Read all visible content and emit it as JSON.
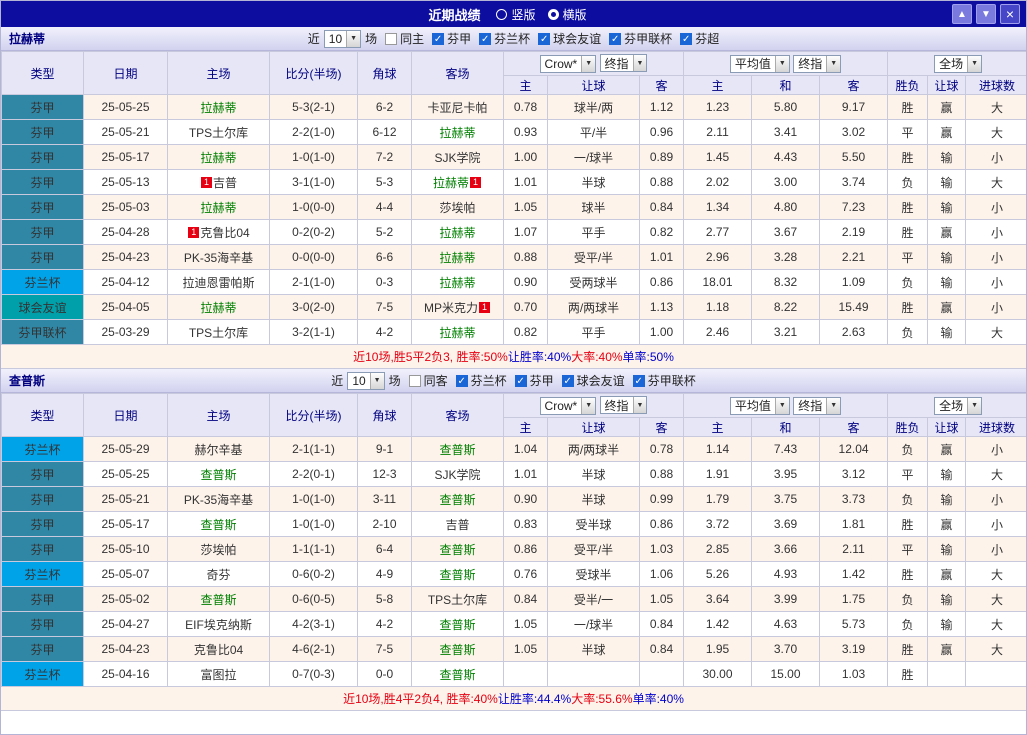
{
  "titlebar": {
    "title": "近期战绩",
    "radios": [
      {
        "label": "竖版",
        "selected": false
      },
      {
        "label": "横版",
        "selected": true
      }
    ],
    "buttons": {
      "up": "▲",
      "down": "▼",
      "close": "×"
    }
  },
  "table_header": {
    "type": "类型",
    "date": "日期",
    "home": "主场",
    "score": "比分(半场)",
    "corner": "角球",
    "away": "客场",
    "odds_select1": "Crow*",
    "odds_select2": "终指",
    "odds_home": "主",
    "odds_line": "让球",
    "odds_away": "客",
    "avg_select1": "平均值",
    "avg_select2": "终指",
    "avg_home": "主",
    "avg_draw": "和",
    "avg_away": "客",
    "result": "胜负",
    "scope_select": "全场",
    "handicap": "让球",
    "goals": "进球数"
  },
  "colors": {
    "titlebar_bg": "#0d0da0",
    "header_bg": "#e6e6f7",
    "section_bar_bg": "#d9d9f2",
    "type_fenjia": "#2f87a5",
    "type_fenlanbei": "#00a2e8",
    "type_friendly": "#00a0aa",
    "type_lianbei_text": "#d4ff7a",
    "win_red": "#e60012",
    "lose_green": "#008800",
    "subject_team_green": "#008000",
    "opponent_team_blue": "#00008b",
    "alt_row_bg": "#fdf3ea",
    "checkbox_blue": "#1a66d6"
  },
  "sections": [
    {
      "team": "拉赫蒂",
      "filter": {
        "prefix": "近",
        "count": "10",
        "suffix": "场",
        "options": [
          {
            "label": "同主",
            "checked": false
          },
          {
            "label": "芬甲",
            "checked": true
          },
          {
            "label": "芬兰杯",
            "checked": true
          },
          {
            "label": "球会友谊",
            "checked": true
          },
          {
            "label": "芬甲联杯",
            "checked": true
          },
          {
            "label": "芬超",
            "checked": true
          }
        ]
      },
      "rows": [
        {
          "type": "芬甲",
          "type_class": "fj",
          "date": "25-05-25",
          "home": "拉赫蒂",
          "home_is_subject": true,
          "home_red_card": false,
          "score": "5-3(2-1)",
          "corners": "6-2",
          "away": "卡亚尼卡帕",
          "away_is_subject": false,
          "away_red_card": false,
          "odds": [
            "0.78",
            "球半/两",
            "1.12"
          ],
          "avg": [
            "1.23",
            "5.80",
            "9.17"
          ],
          "result": "胜",
          "result_class": "c-r",
          "handicap_result": "赢",
          "handicap_class": "c-r",
          "goals_result": "大",
          "goals_class": "c-r"
        },
        {
          "type": "芬甲",
          "type_class": "fj",
          "date": "25-05-21",
          "home": "TPS土尔库",
          "home_is_subject": false,
          "home_red_card": false,
          "score": "2-2(1-0)",
          "corners": "6-12",
          "away": "拉赫蒂",
          "away_is_subject": true,
          "away_red_card": false,
          "odds": [
            "0.93",
            "平/半",
            "0.96"
          ],
          "avg": [
            "2.11",
            "3.41",
            "3.02"
          ],
          "result": "平",
          "result_class": "c-g",
          "handicap_result": "赢",
          "handicap_class": "c-r",
          "goals_result": "大",
          "goals_class": "c-r"
        },
        {
          "type": "芬甲",
          "type_class": "fj",
          "date": "25-05-17",
          "home": "拉赫蒂",
          "home_is_subject": true,
          "home_red_card": false,
          "score": "1-0(1-0)",
          "corners": "7-2",
          "away": "SJK学院",
          "away_is_subject": false,
          "away_red_card": false,
          "odds": [
            "1.00",
            "一/球半",
            "0.89"
          ],
          "avg": [
            "1.45",
            "4.43",
            "5.50"
          ],
          "result": "胜",
          "result_class": "c-r",
          "handicap_result": "输",
          "handicap_class": "c-g",
          "goals_result": "小",
          "goals_class": "c-g"
        },
        {
          "type": "芬甲",
          "type_class": "fj",
          "date": "25-05-13",
          "home": "吉普",
          "home_is_subject": false,
          "home_red_card": true,
          "score": "3-1(1-0)",
          "corners": "5-3",
          "away": "拉赫蒂",
          "away_is_subject": true,
          "away_red_card": true,
          "odds": [
            "1.01",
            "半球",
            "0.88"
          ],
          "avg": [
            "2.02",
            "3.00",
            "3.74"
          ],
          "result": "负",
          "result_class": "c-g",
          "handicap_result": "输",
          "handicap_class": "c-g",
          "goals_result": "大",
          "goals_class": "c-r"
        },
        {
          "type": "芬甲",
          "type_class": "fj",
          "date": "25-05-03",
          "home": "拉赫蒂",
          "home_is_subject": true,
          "home_red_card": false,
          "score": "1-0(0-0)",
          "corners": "4-4",
          "away": "莎埃帕",
          "away_is_subject": false,
          "away_red_card": false,
          "odds": [
            "1.05",
            "球半",
            "0.84"
          ],
          "avg": [
            "1.34",
            "4.80",
            "7.23"
          ],
          "result": "胜",
          "result_class": "c-r",
          "handicap_result": "输",
          "handicap_class": "c-g",
          "goals_result": "小",
          "goals_class": "c-g"
        },
        {
          "type": "芬甲",
          "type_class": "fj",
          "date": "25-04-28",
          "home": "克鲁比04",
          "home_is_subject": false,
          "home_red_card": true,
          "score": "0-2(0-2)",
          "corners": "5-2",
          "away": "拉赫蒂",
          "away_is_subject": true,
          "away_red_card": false,
          "odds": [
            "1.07",
            "平手",
            "0.82"
          ],
          "avg": [
            "2.77",
            "3.67",
            "2.19"
          ],
          "result": "胜",
          "result_class": "c-r",
          "handicap_result": "赢",
          "handicap_class": "c-r",
          "goals_result": "小",
          "goals_class": "c-g"
        },
        {
          "type": "芬甲",
          "type_class": "fj",
          "date": "25-04-23",
          "home": "PK-35海辛基",
          "home_is_subject": false,
          "home_red_card": false,
          "score": "0-0(0-0)",
          "corners": "6-6",
          "away": "拉赫蒂",
          "away_is_subject": true,
          "away_red_card": false,
          "odds": [
            "0.88",
            "受平/半",
            "1.01"
          ],
          "avg": [
            "2.96",
            "3.28",
            "2.21"
          ],
          "result": "平",
          "result_class": "c-g",
          "handicap_result": "输",
          "handicap_class": "c-g",
          "goals_result": "小",
          "goals_class": "c-g"
        },
        {
          "type": "芬兰杯",
          "type_class": "flb",
          "date": "25-04-12",
          "home": "拉迪恩雷帕斯",
          "home_is_subject": false,
          "home_red_card": false,
          "score": "2-1(1-0)",
          "corners": "0-3",
          "away": "拉赫蒂",
          "away_is_subject": true,
          "away_red_card": false,
          "odds": [
            "0.90",
            "受两球半",
            "0.86"
          ],
          "avg": [
            "18.01",
            "8.32",
            "1.09"
          ],
          "result": "负",
          "result_class": "c-g",
          "handicap_result": "输",
          "handicap_class": "c-g",
          "goals_result": "小",
          "goals_class": "c-g"
        },
        {
          "type": "球会友谊",
          "type_class": "qy",
          "date": "25-04-05",
          "home": "拉赫蒂",
          "home_is_subject": true,
          "home_red_card": false,
          "score": "3-0(2-0)",
          "corners": "7-5",
          "away": "MP米克力",
          "away_is_subject": false,
          "away_red_card": true,
          "odds": [
            "0.70",
            "两/两球半",
            "1.13"
          ],
          "avg": [
            "1.18",
            "8.22",
            "15.49"
          ],
          "result": "胜",
          "result_class": "c-r",
          "handicap_result": "赢",
          "handicap_class": "c-r",
          "goals_result": "小",
          "goals_class": "c-g"
        },
        {
          "type": "芬甲联杯",
          "type_class": "lb",
          "date": "25-03-29",
          "home": "TPS土尔库",
          "home_is_subject": false,
          "home_red_card": false,
          "score": "3-2(1-1)",
          "corners": "4-2",
          "away": "拉赫蒂",
          "away_is_subject": true,
          "away_red_card": false,
          "odds": [
            "0.82",
            "平手",
            "1.00"
          ],
          "avg": [
            "2.46",
            "3.21",
            "2.63"
          ],
          "result": "负",
          "result_class": "c-g",
          "handicap_result": "输",
          "handicap_class": "c-g",
          "goals_result": "大",
          "goals_class": "c-r"
        }
      ],
      "summary": [
        {
          "text": "近10场,胜5平2负3, 胜率:50%",
          "color": "#e60012"
        },
        {
          "text": " 让胜率:40%",
          "color": "#0000cc"
        },
        {
          "text": " 大率:40%",
          "color": "#e60012"
        },
        {
          "text": " 单率:50%",
          "color": "#0000cc"
        }
      ]
    },
    {
      "team": "查普斯",
      "filter": {
        "prefix": "近",
        "count": "10",
        "suffix": "场",
        "options": [
          {
            "label": "同客",
            "checked": false
          },
          {
            "label": "芬兰杯",
            "checked": true
          },
          {
            "label": "芬甲",
            "checked": true
          },
          {
            "label": "球会友谊",
            "checked": true
          },
          {
            "label": "芬甲联杯",
            "checked": true
          }
        ]
      },
      "rows": [
        {
          "type": "芬兰杯",
          "type_class": "flb",
          "date": "25-05-29",
          "home": "赫尔辛基",
          "home_is_subject": false,
          "home_red_card": false,
          "score": "2-1(1-1)",
          "corners": "9-1",
          "away": "查普斯",
          "away_is_subject": true,
          "away_red_card": false,
          "odds": [
            "1.04",
            "两/两球半",
            "0.78"
          ],
          "avg": [
            "1.14",
            "7.43",
            "12.04"
          ],
          "result": "负",
          "result_class": "c-g",
          "handicap_result": "赢",
          "handicap_class": "c-r",
          "goals_result": "小",
          "goals_class": "c-g"
        },
        {
          "type": "芬甲",
          "type_class": "fj",
          "date": "25-05-25",
          "home": "查普斯",
          "home_is_subject": true,
          "home_red_card": false,
          "score": "2-2(0-1)",
          "corners": "12-3",
          "away": "SJK学院",
          "away_is_subject": false,
          "away_red_card": false,
          "odds": [
            "1.01",
            "半球",
            "0.88"
          ],
          "avg": [
            "1.91",
            "3.95",
            "3.12"
          ],
          "result": "平",
          "result_class": "c-g",
          "handicap_result": "输",
          "handicap_class": "c-g",
          "goals_result": "大",
          "goals_class": "c-r"
        },
        {
          "type": "芬甲",
          "type_class": "fj",
          "date": "25-05-21",
          "home": "PK-35海辛基",
          "home_is_subject": false,
          "home_red_card": false,
          "score": "1-0(1-0)",
          "corners": "3-11",
          "away": "查普斯",
          "away_is_subject": true,
          "away_red_card": false,
          "odds": [
            "0.90",
            "半球",
            "0.99"
          ],
          "avg": [
            "1.79",
            "3.75",
            "3.73"
          ],
          "result": "负",
          "result_class": "c-g",
          "handicap_result": "输",
          "handicap_class": "c-g",
          "goals_result": "小",
          "goals_class": "c-g"
        },
        {
          "type": "芬甲",
          "type_class": "fj",
          "date": "25-05-17",
          "home": "查普斯",
          "home_is_subject": true,
          "home_red_card": false,
          "score": "1-0(1-0)",
          "corners": "2-10",
          "away": "吉普",
          "away_is_subject": false,
          "away_red_card": false,
          "odds": [
            "0.83",
            "受半球",
            "0.86"
          ],
          "avg": [
            "3.72",
            "3.69",
            "1.81"
          ],
          "result": "胜",
          "result_class": "c-r",
          "handicap_result": "赢",
          "handicap_class": "c-r",
          "goals_result": "小",
          "goals_class": "c-g"
        },
        {
          "type": "芬甲",
          "type_class": "fj",
          "date": "25-05-10",
          "home": "莎埃帕",
          "home_is_subject": false,
          "home_red_card": false,
          "score": "1-1(1-1)",
          "corners": "6-4",
          "away": "查普斯",
          "away_is_subject": true,
          "away_red_card": false,
          "odds": [
            "0.86",
            "受平/半",
            "1.03"
          ],
          "avg": [
            "2.85",
            "3.66",
            "2.11"
          ],
          "result": "平",
          "result_class": "c-g",
          "handicap_result": "输",
          "handicap_class": "c-g",
          "goals_result": "小",
          "goals_class": "c-g"
        },
        {
          "type": "芬兰杯",
          "type_class": "flb",
          "date": "25-05-07",
          "home": "奇芬",
          "home_is_subject": false,
          "home_red_card": false,
          "score": "0-6(0-2)",
          "corners": "4-9",
          "away": "查普斯",
          "away_is_subject": true,
          "away_red_card": false,
          "odds": [
            "0.76",
            "受球半",
            "1.06"
          ],
          "avg": [
            "5.26",
            "4.93",
            "1.42"
          ],
          "result": "胜",
          "result_class": "c-r",
          "handicap_result": "赢",
          "handicap_class": "c-r",
          "goals_result": "大",
          "goals_class": "c-r"
        },
        {
          "type": "芬甲",
          "type_class": "fj",
          "date": "25-05-02",
          "home": "查普斯",
          "home_is_subject": true,
          "home_red_card": false,
          "score": "0-6(0-5)",
          "corners": "5-8",
          "away": "TPS土尔库",
          "away_is_subject": false,
          "away_red_card": false,
          "odds": [
            "0.84",
            "受半/一",
            "1.05"
          ],
          "avg": [
            "3.64",
            "3.99",
            "1.75"
          ],
          "result": "负",
          "result_class": "c-g",
          "handicap_result": "输",
          "handicap_class": "c-g",
          "goals_result": "大",
          "goals_class": "c-r"
        },
        {
          "type": "芬甲",
          "type_class": "fj",
          "date": "25-04-27",
          "home": "EIF埃克纳斯",
          "home_is_subject": false,
          "home_red_card": false,
          "score": "4-2(3-1)",
          "corners": "4-2",
          "away": "查普斯",
          "away_is_subject": true,
          "away_red_card": false,
          "odds": [
            "1.05",
            "一/球半",
            "0.84"
          ],
          "avg": [
            "1.42",
            "4.63",
            "5.73"
          ],
          "result": "负",
          "result_class": "c-g",
          "handicap_result": "输",
          "handicap_class": "c-g",
          "goals_result": "大",
          "goals_class": "c-r"
        },
        {
          "type": "芬甲",
          "type_class": "fj",
          "date": "25-04-23",
          "home": "克鲁比04",
          "home_is_subject": false,
          "home_red_card": false,
          "score": "4-6(2-1)",
          "corners": "7-5",
          "away": "查普斯",
          "away_is_subject": true,
          "away_red_card": false,
          "odds": [
            "1.05",
            "半球",
            "0.84"
          ],
          "avg": [
            "1.95",
            "3.70",
            "3.19"
          ],
          "result": "胜",
          "result_class": "c-r",
          "handicap_result": "赢",
          "handicap_class": "c-r",
          "goals_result": "大",
          "goals_class": "c-r"
        },
        {
          "type": "芬兰杯",
          "type_class": "flb",
          "date": "25-04-16",
          "home": "富图拉",
          "home_is_subject": false,
          "home_red_card": false,
          "score": "0-7(0-3)",
          "corners": "0-0",
          "away": "查普斯",
          "away_is_subject": true,
          "away_red_card": false,
          "odds": [
            "",
            "",
            ""
          ],
          "avg": [
            "30.00",
            "15.00",
            "1.03"
          ],
          "result": "胜",
          "result_class": "c-r",
          "handicap_result": "",
          "handicap_class": "",
          "goals_result": "",
          "goals_class": ""
        }
      ],
      "summary": [
        {
          "text": "近10场,胜4平2负4, 胜率:40%",
          "color": "#e60012"
        },
        {
          "text": " 让胜率:44.4%",
          "color": "#0000cc"
        },
        {
          "text": " 大率:55.6%",
          "color": "#e60012"
        },
        {
          "text": " 单率:40%",
          "color": "#0000cc"
        }
      ]
    }
  ]
}
